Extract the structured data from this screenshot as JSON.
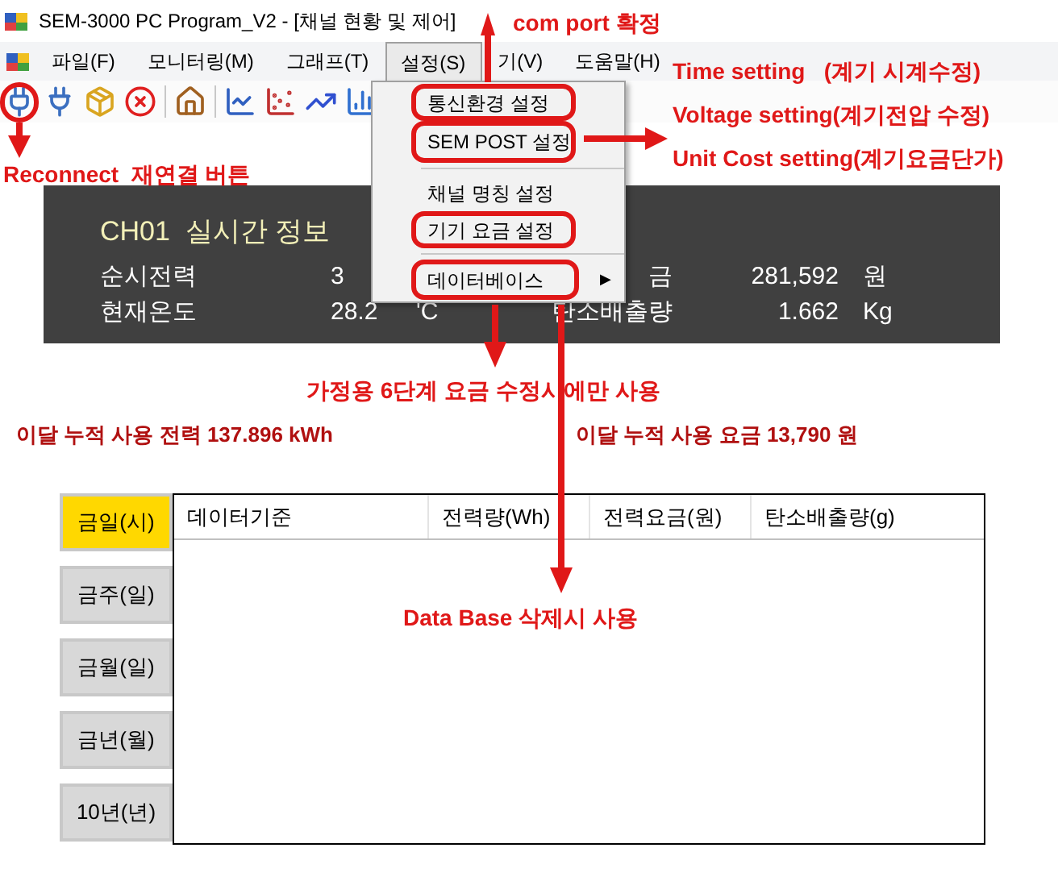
{
  "window": {
    "title": "SEM-3000 PC Program_V2 - [채널 현황 및 제어]"
  },
  "menu_bar": [
    {
      "label": "파일(F)",
      "selected": false
    },
    {
      "label": "모니터링(M)",
      "selected": false
    },
    {
      "label": "그래프(T)",
      "selected": false
    },
    {
      "label": "설정(S)",
      "selected": true
    },
    {
      "label": "기(V)",
      "selected": false
    },
    {
      "label": "도움말(H)",
      "selected": false
    }
  ],
  "dropdown_menu": [
    {
      "kind": "item",
      "label": "통신환경 설정"
    },
    {
      "kind": "item",
      "label": "SEM POST 설정"
    },
    {
      "kind": "separator"
    },
    {
      "kind": "item",
      "label": "채널 명칭 설정"
    },
    {
      "kind": "item",
      "label": "기기 요금 설정"
    },
    {
      "kind": "separator"
    },
    {
      "kind": "submenu",
      "label": "데이터베이스",
      "arrow": "▶"
    }
  ],
  "realtime_panel": {
    "title": "CH01  실시간 정보",
    "rows": [
      {
        "label": "순시전력",
        "value": "3",
        "label_2": "금",
        "value_2": "281,592",
        "unit_2": "원"
      },
      {
        "label": "현재온도",
        "value": "28.2",
        "unit": "'C",
        "label_2": "탄소배출량",
        "value_2": "1.662",
        "unit_2": "Kg"
      }
    ]
  },
  "summary": [
    "이달 누적 사용 전력 137.896 kWh",
    "이달 누적 사용 요금 13,790 원"
  ],
  "period_buttons": [
    {
      "label": "금일(시)",
      "selected": true
    },
    {
      "label": "금주(일)",
      "selected": false
    },
    {
      "label": "금월(일)",
      "selected": false
    },
    {
      "label": "금년(월)",
      "selected": false
    },
    {
      "label": "10년(년)",
      "selected": false
    }
  ],
  "table": {
    "columns": [
      "데이터기준",
      "전력량(Wh)",
      "전력요금(원)",
      "탄소배출량(g)"
    ]
  },
  "annotations": [
    "com port 확정",
    "Time setting   (계기 시계수정)",
    "Voltage setting(계기전압 수정)",
    "Unit Cost setting(계기요금단가)",
    "Reconnect  재연결 버튼",
    "가정용 6단계 요금 수정시에만 사용",
    "Data Base 삭제시 사용"
  ]
}
